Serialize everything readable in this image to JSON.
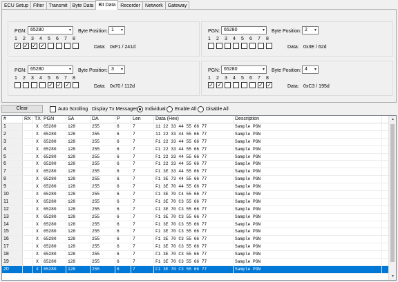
{
  "tabs": [
    "ECU Setup",
    "Filter",
    "Transmit",
    "Byte Data",
    "Bit Data",
    "Recorder",
    "Network",
    "Gateway"
  ],
  "active_tab": "Bit Data",
  "labels": {
    "pgn": "PGN:",
    "byte_position": "Byte Position:",
    "data": "Data:"
  },
  "bit_numbers": [
    "1",
    "2",
    "3",
    "4",
    "5",
    "6",
    "7",
    "8"
  ],
  "bit_groups": [
    {
      "pgn": "65280",
      "byte_position": "1",
      "bits": [
        true,
        true,
        true,
        true,
        false,
        false,
        false,
        false
      ],
      "data": "0xF1 / 241d"
    },
    {
      "pgn": "65280",
      "byte_position": "2",
      "bits": [
        false,
        false,
        false,
        false,
        false,
        false,
        false,
        false
      ],
      "data": "0x3E / 62d"
    },
    {
      "pgn": "65280",
      "byte_position": "3",
      "bits": [
        false,
        false,
        false,
        false,
        true,
        true,
        true,
        false
      ],
      "data": "0x70 / 112d"
    },
    {
      "pgn": "65280",
      "byte_position": "4",
      "bits": [
        true,
        true,
        false,
        false,
        false,
        false,
        true,
        true
      ],
      "data": "0xC3 / 195d"
    }
  ],
  "toolbar": {
    "clear": "Clear",
    "auto_scrolling": "Auto Scrolling",
    "display_tx": "Display Tx Messages:",
    "radio_options": [
      "Individual",
      "Enable All",
      "Disable All"
    ],
    "radio_selected": 0
  },
  "grid": {
    "columns": [
      "#",
      "RX",
      "TX",
      "PGN",
      "SA",
      "DA",
      "P",
      "Len",
      "Data (Hex)",
      "Description"
    ],
    "selected_row": 20,
    "rows": [
      [
        "1",
        "",
        "X",
        "65280",
        "128",
        "255",
        "6",
        "7",
        "11 22 33 44 55 66 77",
        "Sample PGN"
      ],
      [
        "2",
        "",
        "X",
        "65280",
        "128",
        "255",
        "6",
        "7",
        "11 22 33 44 55 66 77",
        "Sample PGN"
      ],
      [
        "3",
        "",
        "X",
        "65280",
        "128",
        "255",
        "6",
        "7",
        "F1 22 33 44 55 66 77",
        "Sample PGN"
      ],
      [
        "4",
        "",
        "X",
        "65280",
        "128",
        "255",
        "6",
        "7",
        "F1 22 33 44 55 66 77",
        "Sample PGN"
      ],
      [
        "5",
        "",
        "X",
        "65280",
        "128",
        "255",
        "6",
        "7",
        "F1 22 33 44 55 66 77",
        "Sample PGN"
      ],
      [
        "6",
        "",
        "X",
        "65280",
        "128",
        "255",
        "6",
        "7",
        "F1 22 33 44 55 66 77",
        "Sample PGN"
      ],
      [
        "7",
        "",
        "X",
        "65280",
        "128",
        "255",
        "6",
        "7",
        "F1 3E 33 44 55 66 77",
        "Sample PGN"
      ],
      [
        "8",
        "",
        "X",
        "65280",
        "128",
        "255",
        "6",
        "7",
        "F1 3E 73 44 55 66 77",
        "Sample PGN"
      ],
      [
        "9",
        "",
        "X",
        "65280",
        "128",
        "255",
        "6",
        "7",
        "F1 3E 70 44 55 66 77",
        "Sample PGN"
      ],
      [
        "10",
        "",
        "X",
        "65280",
        "128",
        "255",
        "6",
        "7",
        "F1 3E 70 C4 55 66 77",
        "Sample PGN"
      ],
      [
        "11",
        "",
        "X",
        "65280",
        "128",
        "255",
        "6",
        "7",
        "F1 3E 70 C3 55 66 77",
        "Sample PGN"
      ],
      [
        "12",
        "",
        "X",
        "65280",
        "128",
        "255",
        "6",
        "7",
        "F1 3E 70 C3 55 66 77",
        "Sample PGN"
      ],
      [
        "13",
        "",
        "X",
        "65280",
        "128",
        "255",
        "6",
        "7",
        "F1 3E 70 C3 55 66 77",
        "Sample PGN"
      ],
      [
        "14",
        "",
        "X",
        "65280",
        "128",
        "255",
        "6",
        "7",
        "F1 3E 70 C3 55 66 77",
        "Sample PGN"
      ],
      [
        "15",
        "",
        "X",
        "65280",
        "128",
        "255",
        "6",
        "7",
        "F1 3E 70 C3 55 66 77",
        "Sample PGN"
      ],
      [
        "16",
        "",
        "X",
        "65280",
        "128",
        "255",
        "6",
        "7",
        "F1 3E 70 C3 55 66 77",
        "Sample PGN"
      ],
      [
        "17",
        "",
        "X",
        "65280",
        "128",
        "255",
        "6",
        "7",
        "F1 3E 70 C3 55 66 77",
        "Sample PGN"
      ],
      [
        "18",
        "",
        "X",
        "65280",
        "128",
        "255",
        "6",
        "7",
        "F1 3E 70 C3 55 66 77",
        "Sample PGN"
      ],
      [
        "19",
        "",
        "X",
        "65280",
        "128",
        "255",
        "6",
        "7",
        "F1 3E 70 C3 55 66 77",
        "Sample PGN"
      ],
      [
        "20",
        "",
        "X",
        "65280",
        "128",
        "255",
        "6",
        "7",
        "F1 3E 70 C3 55 66 77",
        "Sample PGN"
      ]
    ]
  },
  "colors": {
    "selection": "#0078d7",
    "panel": "#f0f0f0"
  }
}
